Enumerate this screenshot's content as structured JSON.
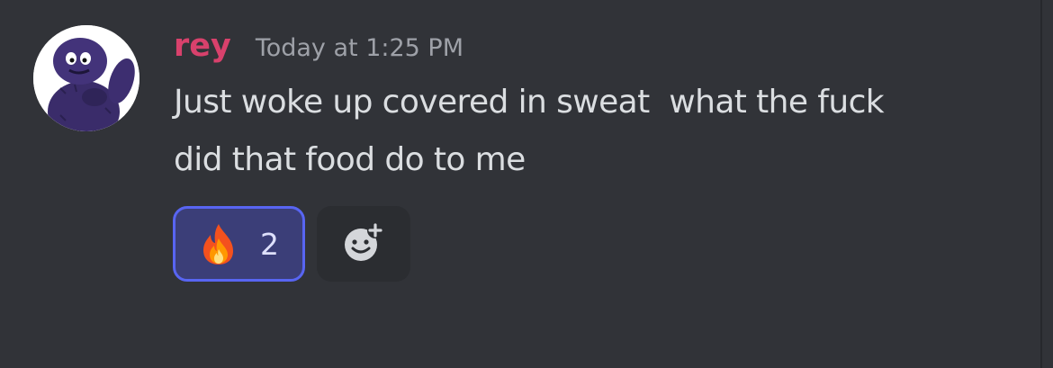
{
  "message": {
    "username": "rey",
    "timestamp": "Today at 1:25 PM",
    "content_lines": [
      "Just woke up covered in sweat  what the fuck",
      "did that food do to me"
    ]
  },
  "reactions": [
    {
      "emoji": "fire-emoji",
      "count": "2",
      "active": true
    }
  ],
  "add_reaction": {
    "icon": "add-reaction-icon"
  },
  "colors": {
    "background": "#313338",
    "username": "#d8416c",
    "timestamp": "#9ea1a8",
    "text": "#dbdee1",
    "reaction_active_bg": "#3b3e78",
    "reaction_active_border": "#5865f2"
  }
}
